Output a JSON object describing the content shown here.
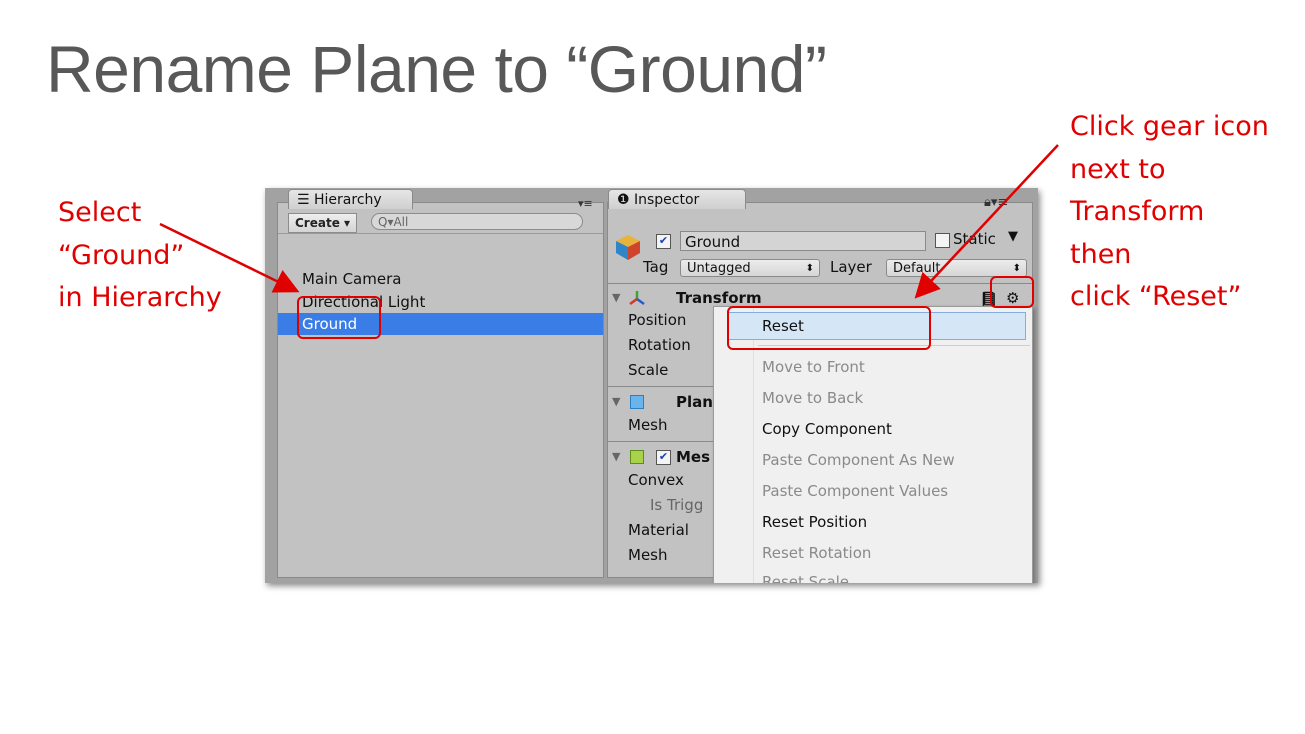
{
  "slide": {
    "title": "Rename Plane to “Ground”",
    "annotation_left": "Select\n“Ground”\nin Hierarchy",
    "annotation_right": "Click gear icon\nnext to\nTransform\nthen\nclick “Reset”"
  },
  "hierarchy": {
    "tab_label": "☰ Hierarchy",
    "create_label": "Create ▾",
    "search_placeholder": "Q▾All",
    "items": [
      "Main Camera",
      "Directional Light",
      "Ground"
    ],
    "selected_item": "Ground"
  },
  "inspector": {
    "tab_label": "❶ Inspector",
    "object_name": "Ground",
    "static_label": "Static",
    "tag_label": "Tag",
    "tag_value": "Untagged",
    "layer_label": "Layer",
    "layer_value": "Default",
    "transform": {
      "title": "Transform",
      "props": [
        "Position",
        "Rotation",
        "Scale"
      ]
    },
    "plane": {
      "title": "Plan",
      "props": [
        "Mesh"
      ]
    },
    "mesh_collider": {
      "title": "Mes",
      "props": [
        "Convex",
        "Is Trigg",
        "Material",
        "Mesh"
      ]
    }
  },
  "context_menu": {
    "items": [
      {
        "label": "Reset",
        "enabled": true
      },
      {
        "label": "Move to Front",
        "enabled": false
      },
      {
        "label": "Move to Back",
        "enabled": false
      },
      {
        "label": "Copy Component",
        "enabled": true
      },
      {
        "label": "Paste Component As New",
        "enabled": false
      },
      {
        "label": "Paste Component Values",
        "enabled": false
      },
      {
        "label": "Reset Position",
        "enabled": true
      },
      {
        "label": "Reset Rotation",
        "enabled": false
      },
      {
        "label": "Reset Scale",
        "enabled": false
      }
    ]
  },
  "icons": [
    "hierarchy-list-icon",
    "info-icon",
    "lock-icon",
    "gameobject-cube-icon",
    "transform-axes-icon",
    "mesh-filter-icon",
    "mesh-collider-icon",
    "help-book-icon",
    "gear-icon"
  ],
  "colors": {
    "annotation": "#e00000",
    "selection": "#3b7de6",
    "menu_highlight": "#d5e6f7"
  }
}
